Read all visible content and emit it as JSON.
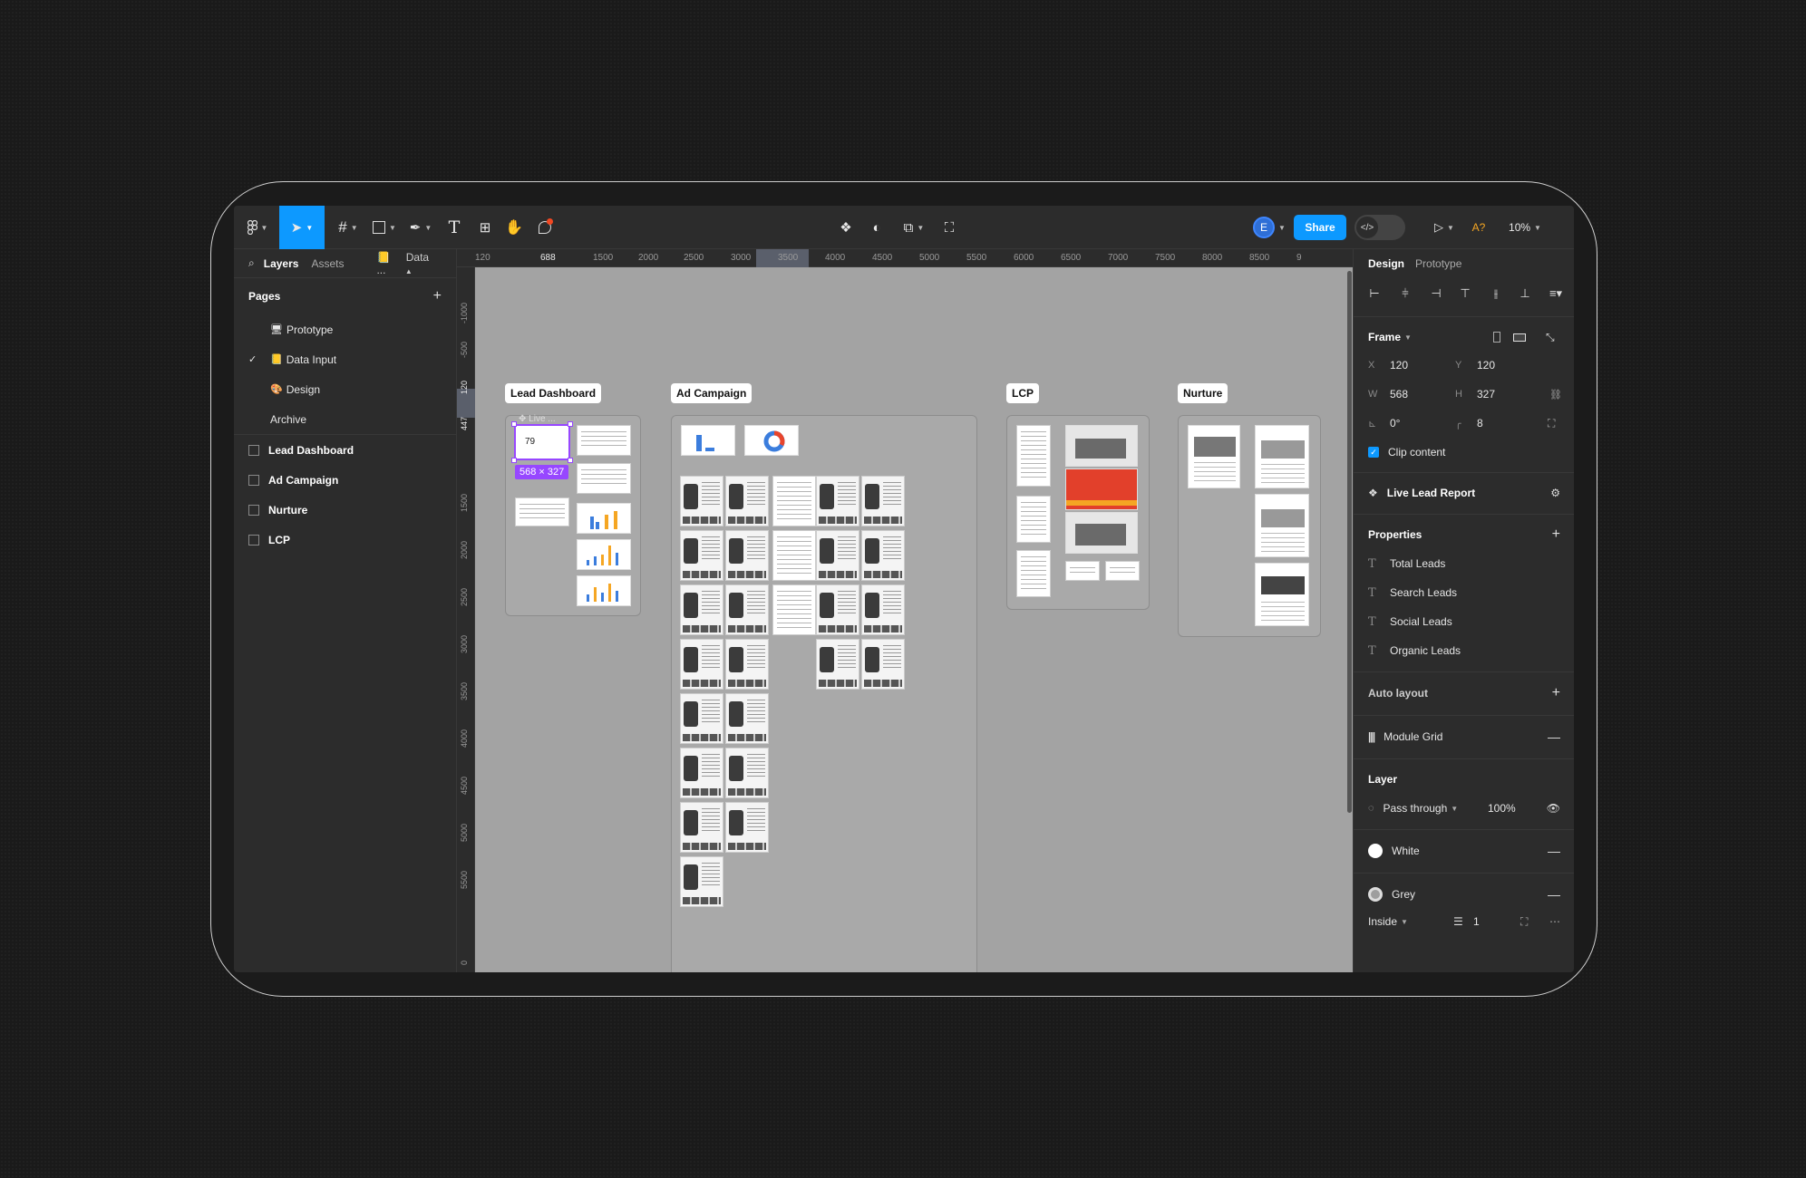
{
  "toolbar": {
    "zoom": "10%",
    "share_label": "Share",
    "avatar_initial": "E",
    "font_missing": "A?"
  },
  "left_panel": {
    "tabs": [
      "Layers",
      "Assets"
    ],
    "page_selector": "Data ...",
    "pages_title": "Pages",
    "pages": [
      {
        "label": "Prototype",
        "emoji": "🖥"
      },
      {
        "label": "Data Input",
        "emoji": "📒",
        "current": true
      },
      {
        "label": "Design",
        "emoji": "🎨"
      },
      {
        "label": "Archive",
        "emoji": ""
      }
    ],
    "layers": [
      "Lead Dashboard",
      "Ad Campaign",
      "Nurture",
      "LCP"
    ]
  },
  "rulers": {
    "top": [
      "120",
      "688",
      "1500",
      "2000",
      "2500",
      "3000",
      "3500",
      "4000",
      "4500",
      "5000",
      "5500",
      "6000",
      "6500",
      "7000",
      "7500",
      "8000",
      "8500",
      "9"
    ],
    "left": [
      "-1000",
      "-500",
      "120",
      "447",
      "1500",
      "2000",
      "2500",
      "3000",
      "3500",
      "4000",
      "4500",
      "5000",
      "5500",
      "0"
    ]
  },
  "canvas": {
    "sections": [
      "Lead Dashboard",
      "Ad Campaign",
      "LCP",
      "Nurture"
    ],
    "selected_frame_label": "Live ...",
    "selected_frame_number": "79",
    "selection_size": "568 × 327"
  },
  "right_panel": {
    "tabs": [
      "Design",
      "Prototype"
    ],
    "frame_title": "Frame",
    "x_label": "X",
    "x_value": "120",
    "y_label": "Y",
    "y_value": "120",
    "w_label": "W",
    "w_value": "568",
    "h_label": "H",
    "h_value": "327",
    "rotation": "0°",
    "radius": "8",
    "clip_content": "Clip content",
    "component_name": "Live Lead Report",
    "properties_title": "Properties",
    "properties": [
      "Total Leads",
      "Search Leads",
      "Social Leads",
      "Organic Leads"
    ],
    "auto_layout": "Auto layout",
    "grid_name": "Module Grid",
    "layer_title": "Layer",
    "blend_mode": "Pass through",
    "opacity": "100%",
    "fills": [
      {
        "name": "White",
        "color": "#ffffff"
      },
      {
        "name": "Grey",
        "color": "#9e9e9e"
      }
    ],
    "stroke_position": "Inside",
    "stroke_weight": "1"
  },
  "colors": {
    "accent": "#0d99ff",
    "selection": "#9747ff",
    "canvas": "#a3a3a3"
  }
}
